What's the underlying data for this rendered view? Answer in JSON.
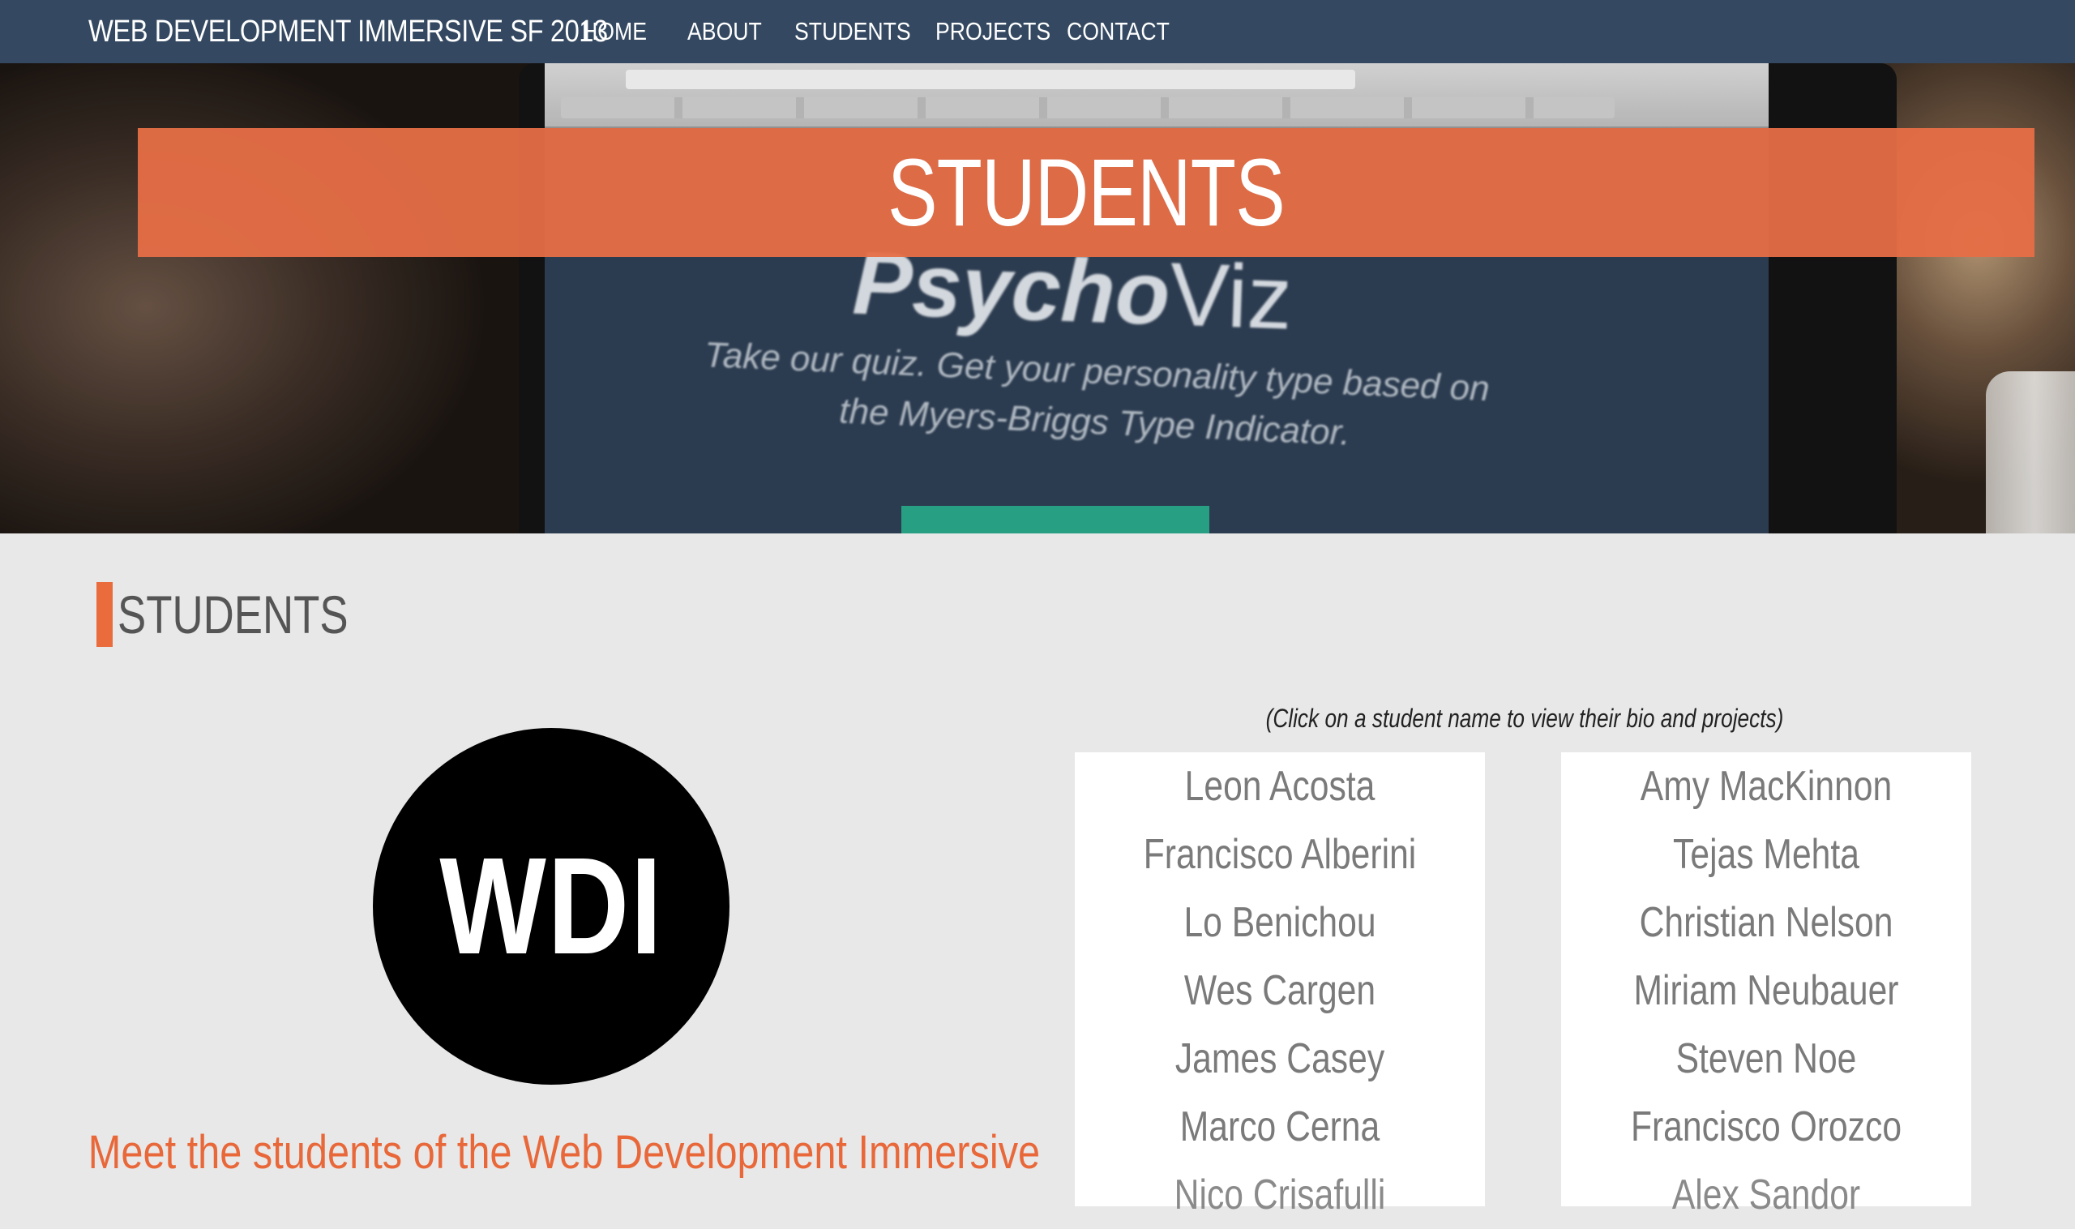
{
  "nav": {
    "brand": "WEB DEVELOPMENT IMMERSIVE SF 2013",
    "links": [
      "HOME",
      "ABOUT",
      "STUDENTS",
      "PROJECTS",
      "CONTACT"
    ]
  },
  "hero": {
    "banner_title": "STUDENTS",
    "screen_title_bold": "Psycho",
    "screen_title_light": "Viz",
    "screen_subtitle": "Take our quiz. Get your personality type based on the Myers-Briggs Type Indicator."
  },
  "section": {
    "heading": "STUDENTS",
    "logo_text": "WDI",
    "meet_text": "Meet the students of the Web Development Immersive",
    "click_hint": "(Click on a student name to view their bio and projects)"
  },
  "students": {
    "column_1": [
      "Leon Acosta",
      "Francisco Alberini",
      "Lo Benichou",
      "Wes Cargen",
      "James Casey",
      "Marco Cerna",
      "Nico Crisafulli"
    ],
    "column_2": [
      "Amy MacKinnon",
      "Tejas Mehta",
      "Christian Nelson",
      "Miriam Neubauer",
      "Steven Noe",
      "Francisco Orozco",
      "Alex Sandor"
    ]
  },
  "colors": {
    "navbar": "#344961",
    "accent": "#ea6b3c",
    "background": "#e8e8e8"
  }
}
